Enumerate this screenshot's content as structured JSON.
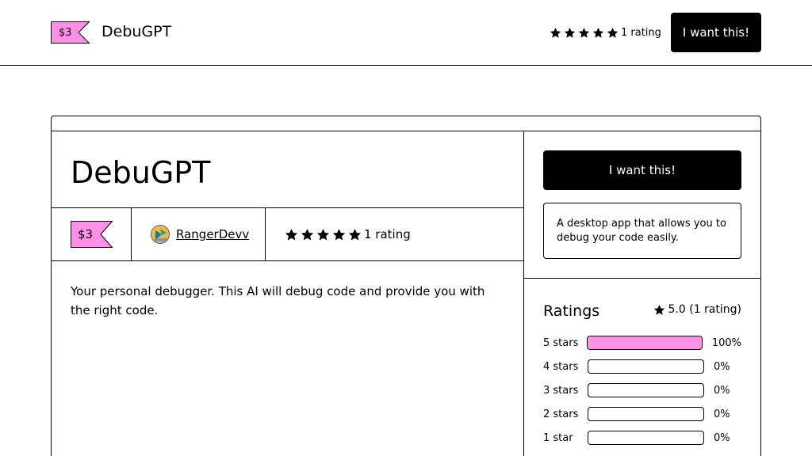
{
  "colors": {
    "accent_pink": "#ff90e8",
    "button_bg": "#000000",
    "button_text": "#ffffff"
  },
  "header": {
    "price": "$3",
    "product_name": "DebuGPT",
    "rating_text": "1 rating",
    "star_count": 5,
    "cta_label": "I want this!"
  },
  "product": {
    "title": "DebuGPT",
    "price": "$3",
    "author": "RangerDevv",
    "rating_text": "1 rating",
    "description": "Your personal debugger. This AI will debug code and provide you with the right code."
  },
  "sidebar": {
    "cta_label": "I want this!",
    "summary": "A desktop app that allows you to debug your code easily.",
    "ratings": {
      "heading": "Ratings",
      "summary": "5.0 (1 rating)",
      "rows": [
        {
          "label": "5 stars",
          "percent": "100%",
          "fraction": 1.0
        },
        {
          "label": "4 stars",
          "percent": "0%",
          "fraction": 0
        },
        {
          "label": "3 stars",
          "percent": "0%",
          "fraction": 0
        },
        {
          "label": "2 stars",
          "percent": "0%",
          "fraction": 0
        },
        {
          "label": "1 star",
          "percent": "0%",
          "fraction": 0
        }
      ]
    }
  },
  "icons": {
    "star": "star-icon",
    "price_tag": "price-tag-icon",
    "avatar": "avatar-icon"
  }
}
